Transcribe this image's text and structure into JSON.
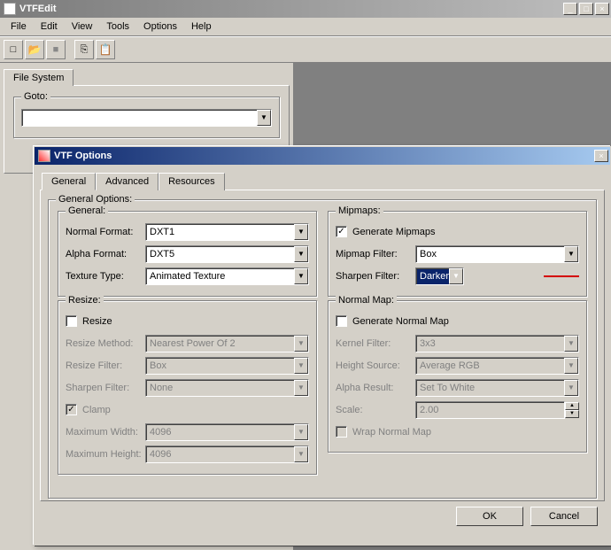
{
  "app": {
    "title": "VTFEdit"
  },
  "menu": {
    "file": "File",
    "edit": "Edit",
    "view": "View",
    "tools": "Tools",
    "options": "Options",
    "help": "Help"
  },
  "sidebar": {
    "tab": "File System",
    "goto_label": "Goto:",
    "goto_value": ""
  },
  "dialog": {
    "title": "VTF Options",
    "tabs": {
      "general": "General",
      "advanced": "Advanced",
      "resources": "Resources"
    },
    "general_options_legend": "General Options:",
    "general": {
      "legend": "General:",
      "normal_format_label": "Normal Format:",
      "normal_format_value": "DXT1",
      "alpha_format_label": "Alpha Format:",
      "alpha_format_value": "DXT5",
      "texture_type_label": "Texture Type:",
      "texture_type_value": "Animated Texture"
    },
    "resize": {
      "legend": "Resize:",
      "resize_label": "Resize",
      "method_label": "Resize Method:",
      "method_value": "Nearest Power Of 2",
      "filter_label": "Resize Filter:",
      "filter_value": "Box",
      "sharpen_label": "Sharpen Filter:",
      "sharpen_value": "None",
      "clamp_label": "Clamp",
      "maxw_label": "Maximum Width:",
      "maxw_value": "4096",
      "maxh_label": "Maximum Height:",
      "maxh_value": "4096"
    },
    "mipmaps": {
      "legend": "Mipmaps:",
      "generate_label": "Generate Mipmaps",
      "filter_label": "Mipmap Filter:",
      "filter_value": "Box",
      "sharpen_label": "Sharpen Filter:",
      "sharpen_value": "Darker"
    },
    "normalmap": {
      "legend": "Normal Map:",
      "generate_label": "Generate Normal Map",
      "kernel_label": "Kernel Filter:",
      "kernel_value": "3x3",
      "height_label": "Height Source:",
      "height_value": "Average RGB",
      "alpha_label": "Alpha Result:",
      "alpha_value": "Set To White",
      "scale_label": "Scale:",
      "scale_value": "2.00",
      "wrap_label": "Wrap Normal Map"
    },
    "buttons": {
      "ok": "OK",
      "cancel": "Cancel"
    }
  },
  "icons": {
    "new": "□",
    "open": "📂",
    "save": "■",
    "copy": "⎘",
    "paste": "📋"
  }
}
